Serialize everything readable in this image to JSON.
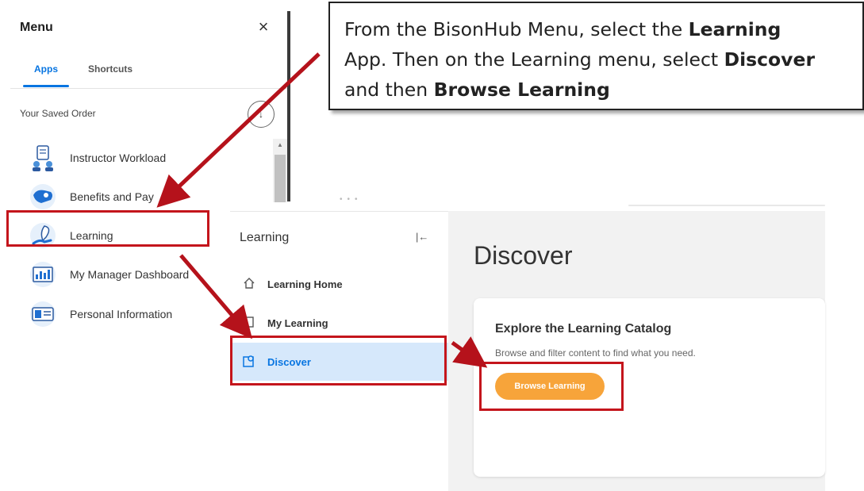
{
  "menu": {
    "title": "Menu",
    "close_icon": "×",
    "tabs": [
      {
        "label": "Apps"
      },
      {
        "label": "Shortcuts"
      }
    ],
    "saved_order_label": "Your Saved Order",
    "sort_icon": "↓",
    "apps": [
      {
        "label": "Instructor Workload",
        "icon": "instructor-workload-icon"
      },
      {
        "label": "Benefits and Pay",
        "icon": "benefits-pay-icon"
      },
      {
        "label": "Learning",
        "icon": "learning-icon"
      },
      {
        "label": "My Manager Dashboard",
        "icon": "manager-dashboard-icon"
      },
      {
        "label": "Personal Information",
        "icon": "personal-information-icon"
      }
    ]
  },
  "callout": {
    "line1_pre": "From the BisonHub Menu, select the ",
    "line1_bold": "Learning",
    "line2_pre": "App. Then on the Learning menu, select ",
    "line2_bold": "Discover",
    "line3_pre": "and then ",
    "line3_bold": "Browse Learning"
  },
  "learning_panel": {
    "title": "Learning",
    "collapse_icon": "|←",
    "items": [
      {
        "label": "Learning Home",
        "icon": "home-icon"
      },
      {
        "label": "My Learning",
        "icon": "book-icon"
      },
      {
        "label": "Discover",
        "icon": "discover-icon"
      }
    ]
  },
  "discover": {
    "title": "Discover",
    "card_heading": "Explore the Learning Catalog",
    "card_description": "Browse and filter content to find what you need.",
    "button_label": "Browse Learning"
  },
  "colors": {
    "accent_blue": "#0875e1",
    "highlight_red": "#c4151c",
    "button_orange": "#f7a43a",
    "active_item_bg": "#d6e8fb"
  }
}
